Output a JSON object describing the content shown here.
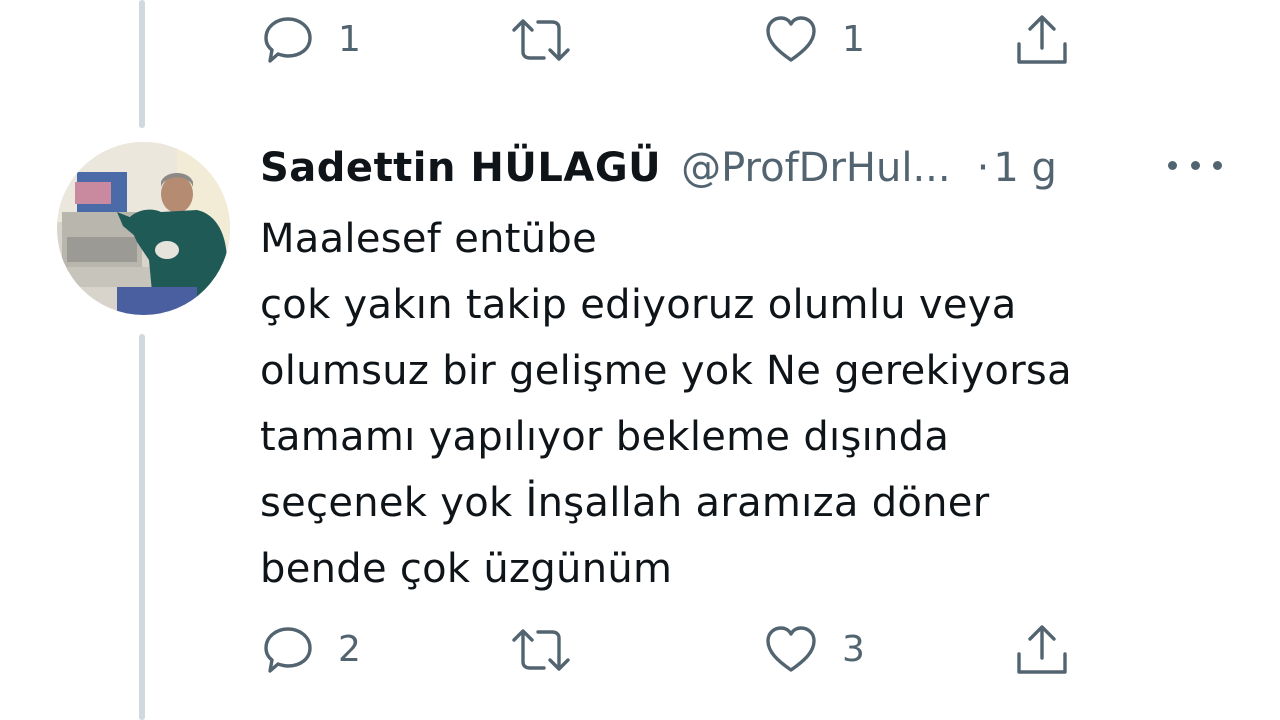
{
  "previous_tweet": {
    "actions": {
      "reply_count": "1",
      "retweet_count": "",
      "like_count": "1"
    }
  },
  "tweet": {
    "display_name": "Sadettin HÜLAGÜ",
    "handle": "@ProfDrHul...",
    "separator": "·",
    "time": "1 g",
    "text_lines": [
      "Maalesef entübe",
      "çok yakın takip ediyoruz olumlu veya",
      "olumsuz bir gelişme yok Ne gerekiyorsa",
      "tamamı yapılıyor bekleme dışında",
      "seçenek yok İnşallah aramıza döner",
      "bende çok üzgünüm"
    ],
    "actions": {
      "reply_count": "2",
      "retweet_count": "",
      "like_count": "3"
    }
  },
  "icons": {
    "reply": "reply-bubble-icon",
    "retweet": "retweet-icon",
    "like": "heart-icon",
    "share": "share-upload-icon",
    "more": "more-dots-icon"
  },
  "colors": {
    "text_primary": "#0f1419",
    "text_secondary": "#536471",
    "thread_line": "#cfd9de"
  }
}
